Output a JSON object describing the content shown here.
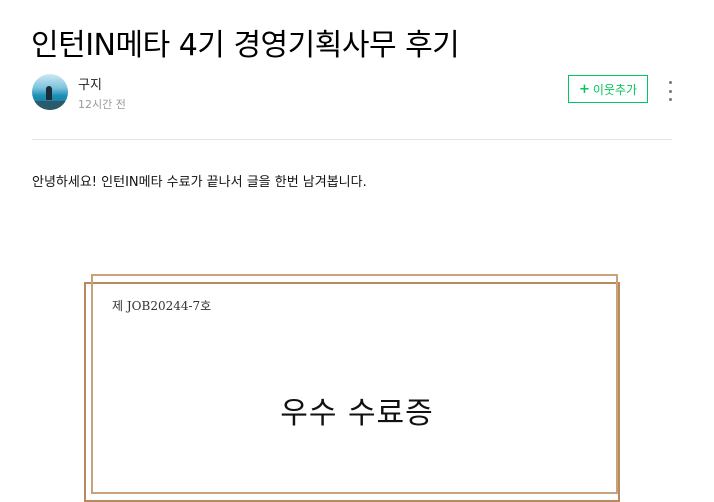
{
  "post": {
    "title": "인턴IN메타 4기 경영기획사무 후기",
    "author": "구지",
    "time": "12시간 전",
    "follow_label": "이웃추가",
    "follow_icon": "plus-icon",
    "more_icon": "more-vertical-icon",
    "body_text": "안녕하세요! 인턴IN메타 수료가 끝나서 글을 한번 남겨봅니다."
  },
  "certificate": {
    "number": "제 JOB20244-7호",
    "title": "우수 수료증"
  },
  "colors": {
    "accent": "#03c75a",
    "frame": "#b98a5e",
    "divider": "#e5e5e5"
  }
}
